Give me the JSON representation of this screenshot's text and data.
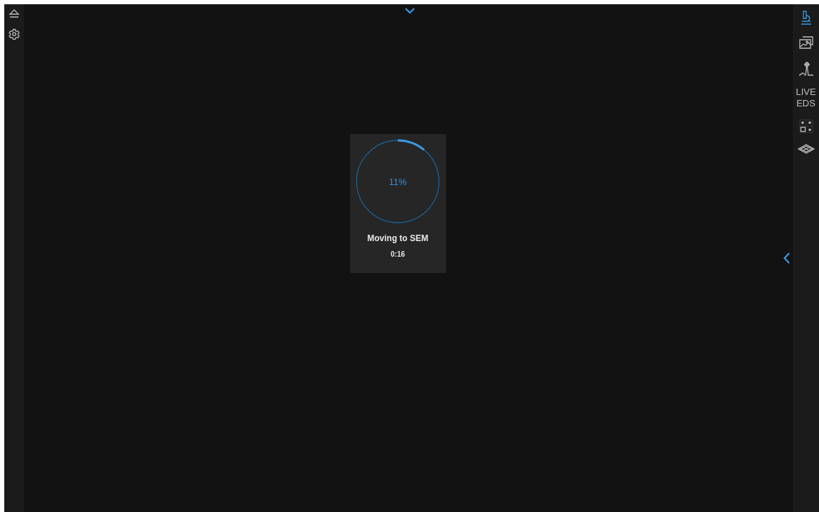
{
  "left_toolbar": [
    {
      "kind": "eject"
    },
    {
      "kind": "settings"
    }
  ],
  "right_toolbar": [
    {
      "kind": "microscope",
      "selected": true
    },
    {
      "kind": "images",
      "selected": false
    },
    {
      "kind": "spectrum",
      "selected": false
    },
    {
      "kind": "text",
      "label": "LIVE EDS",
      "selected": false
    },
    {
      "kind": "grid",
      "selected": false
    },
    {
      "kind": "layers",
      "selected": false
    }
  ],
  "progress": {
    "percent": "11%",
    "status": "Moving to SEM",
    "time": "0:16"
  }
}
